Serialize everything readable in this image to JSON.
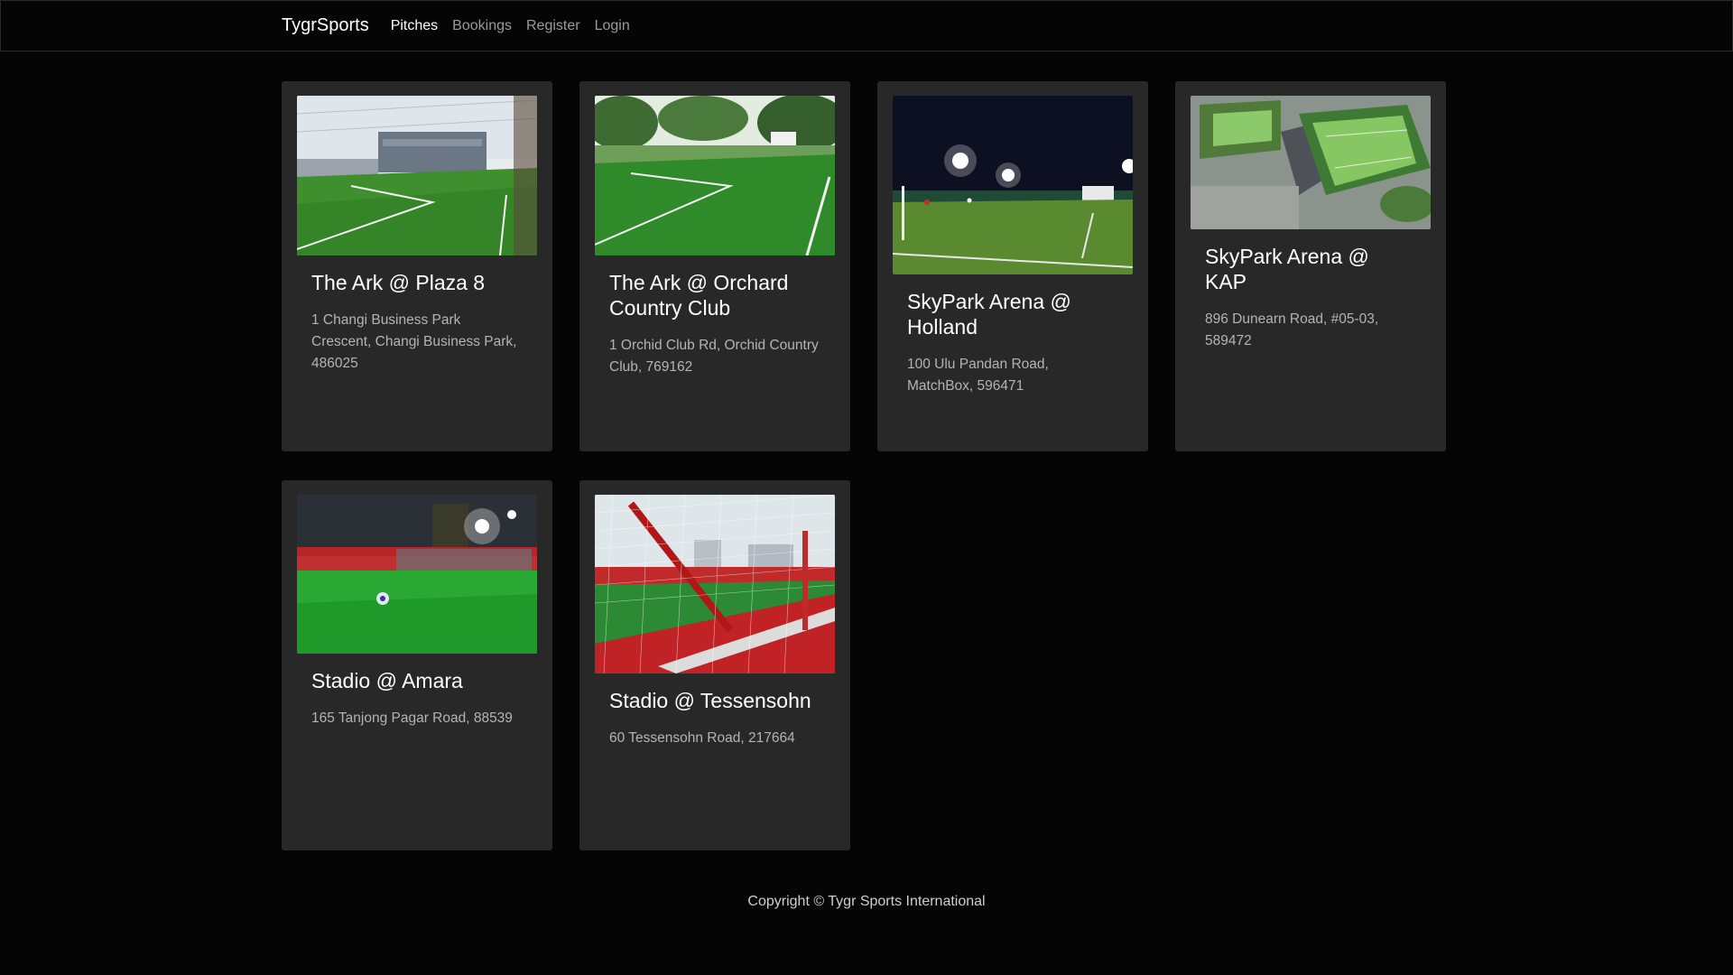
{
  "nav": {
    "brand": "TygrSports",
    "links": [
      "Pitches",
      "Bookings",
      "Register",
      "Login"
    ]
  },
  "pitches": [
    {
      "name": "The Ark @ Plaza 8",
      "address": "1 Changi Business Park Crescent, Changi Business Park, 486025"
    },
    {
      "name": "The Ark @ Orchard Country Club",
      "address": "1 Orchid Club Rd, Orchid Country Club, 769162"
    },
    {
      "name": "SkyPark Arena @ Holland",
      "address": "100 Ulu Pandan Road, MatchBox, 596471"
    },
    {
      "name": "SkyPark Arena @ KAP",
      "address": "896 Dunearn Road, #05-03, 589472"
    },
    {
      "name": "Stadio @ Amara",
      "address": "165 Tanjong Pagar Road, 88539"
    },
    {
      "name": "Stadio @ Tessensohn",
      "address": "60 Tessensohn Road, 217664"
    }
  ],
  "footer": {
    "text": "Copyright © Tygr Sports International"
  },
  "colors": {
    "background": "#050505",
    "card": "#282828",
    "pitch_green": "#2f8a2a"
  }
}
